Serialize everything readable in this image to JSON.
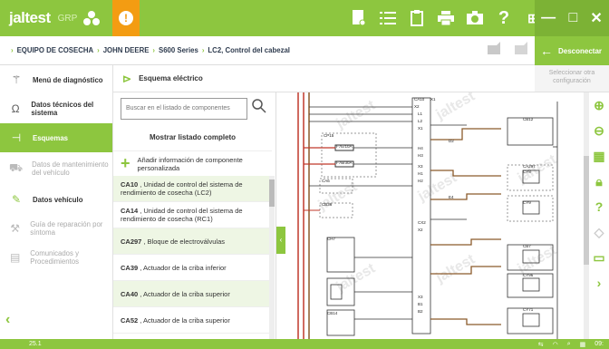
{
  "app": {
    "brand": "jaltest",
    "brand_sub": "GRP",
    "alert": "!"
  },
  "topbar": {
    "icons": [
      "report-icon",
      "list-icon",
      "clipboard-icon",
      "printer-icon",
      "camera-icon",
      "help-icon"
    ],
    "help": "?",
    "window": {
      "grid": "⊞",
      "minimize": "—",
      "maximize": "□",
      "close": "✕"
    }
  },
  "breadcrumb": [
    "EQUIPO DE COSECHA",
    "JOHN DEERE",
    "S600 Series",
    "LC2, Control del cabezal"
  ],
  "actions": {
    "disconnect": "Desconectar",
    "other_config": "Seleccionar otra configuración"
  },
  "sidebar": {
    "items": [
      {
        "label": "Menú de diagnóstico",
        "icon": "diagnostic-icon",
        "state": "normal"
      },
      {
        "label": "Datos técnicos del sistema",
        "icon": "omega-icon",
        "state": "normal"
      },
      {
        "label": "Esquemas",
        "icon": "schema-icon",
        "state": "active"
      },
      {
        "label": "Datos de mantenimiento del vehículo",
        "icon": "vehicle-icon",
        "state": "muted"
      },
      {
        "label": "Datos vehículo",
        "icon": "wrench-icon",
        "state": "normal"
      },
      {
        "label": "Guía de reparación por síntoma",
        "icon": "guide-icon",
        "state": "muted"
      },
      {
        "label": "Comunicados y Procedimientos",
        "icon": "document-icon",
        "state": "muted"
      }
    ]
  },
  "panel": {
    "title": "Esquema eléctrico",
    "search_placeholder": "Buscar en el listado de componentes",
    "show_all": "Mostrar listado completo",
    "add_info": "Añadir información de componente personalizada",
    "components": [
      {
        "code": "CA10",
        "desc": ", Unidad de control del sistema de rendimiento de cosecha (LC2)"
      },
      {
        "code": "CA14",
        "desc": ", Unidad de control del sistema de rendimiento de cosecha (RC1)"
      },
      {
        "code": "CA297",
        "desc": ", Bloque de electroválvulas"
      },
      {
        "code": "CA39",
        "desc": ", Actuador de la criba inferior"
      },
      {
        "code": "CA40",
        "desc": ", Actuador de la criba superior"
      },
      {
        "code": "CA52",
        "desc": ", Actuador de la criba superior"
      }
    ]
  },
  "diagram": {
    "labels": [
      "CA10",
      "X2",
      "X1",
      "L1",
      "L2",
      "X1",
      "CP15",
      "F7E/10A",
      "F7B/30A",
      "H4",
      "H3",
      "X3",
      "H1",
      "H2",
      "CB12",
      "CA297",
      "CY8",
      "CY9",
      "CB7",
      "CY96",
      "CY71",
      "CB14",
      "CA6",
      "CB36",
      "CH7",
      "X3",
      "B1",
      "B2",
      "CX2",
      "X2",
      "E4",
      "D2"
    ],
    "watermark": "jaltest"
  },
  "footer": {
    "version": "25.1",
    "time": "09:"
  },
  "colors": {
    "brand": "#8dc63f",
    "alert": "#f39c12",
    "wire_red": "#c0392b",
    "wire_brown": "#8b5a2b"
  }
}
